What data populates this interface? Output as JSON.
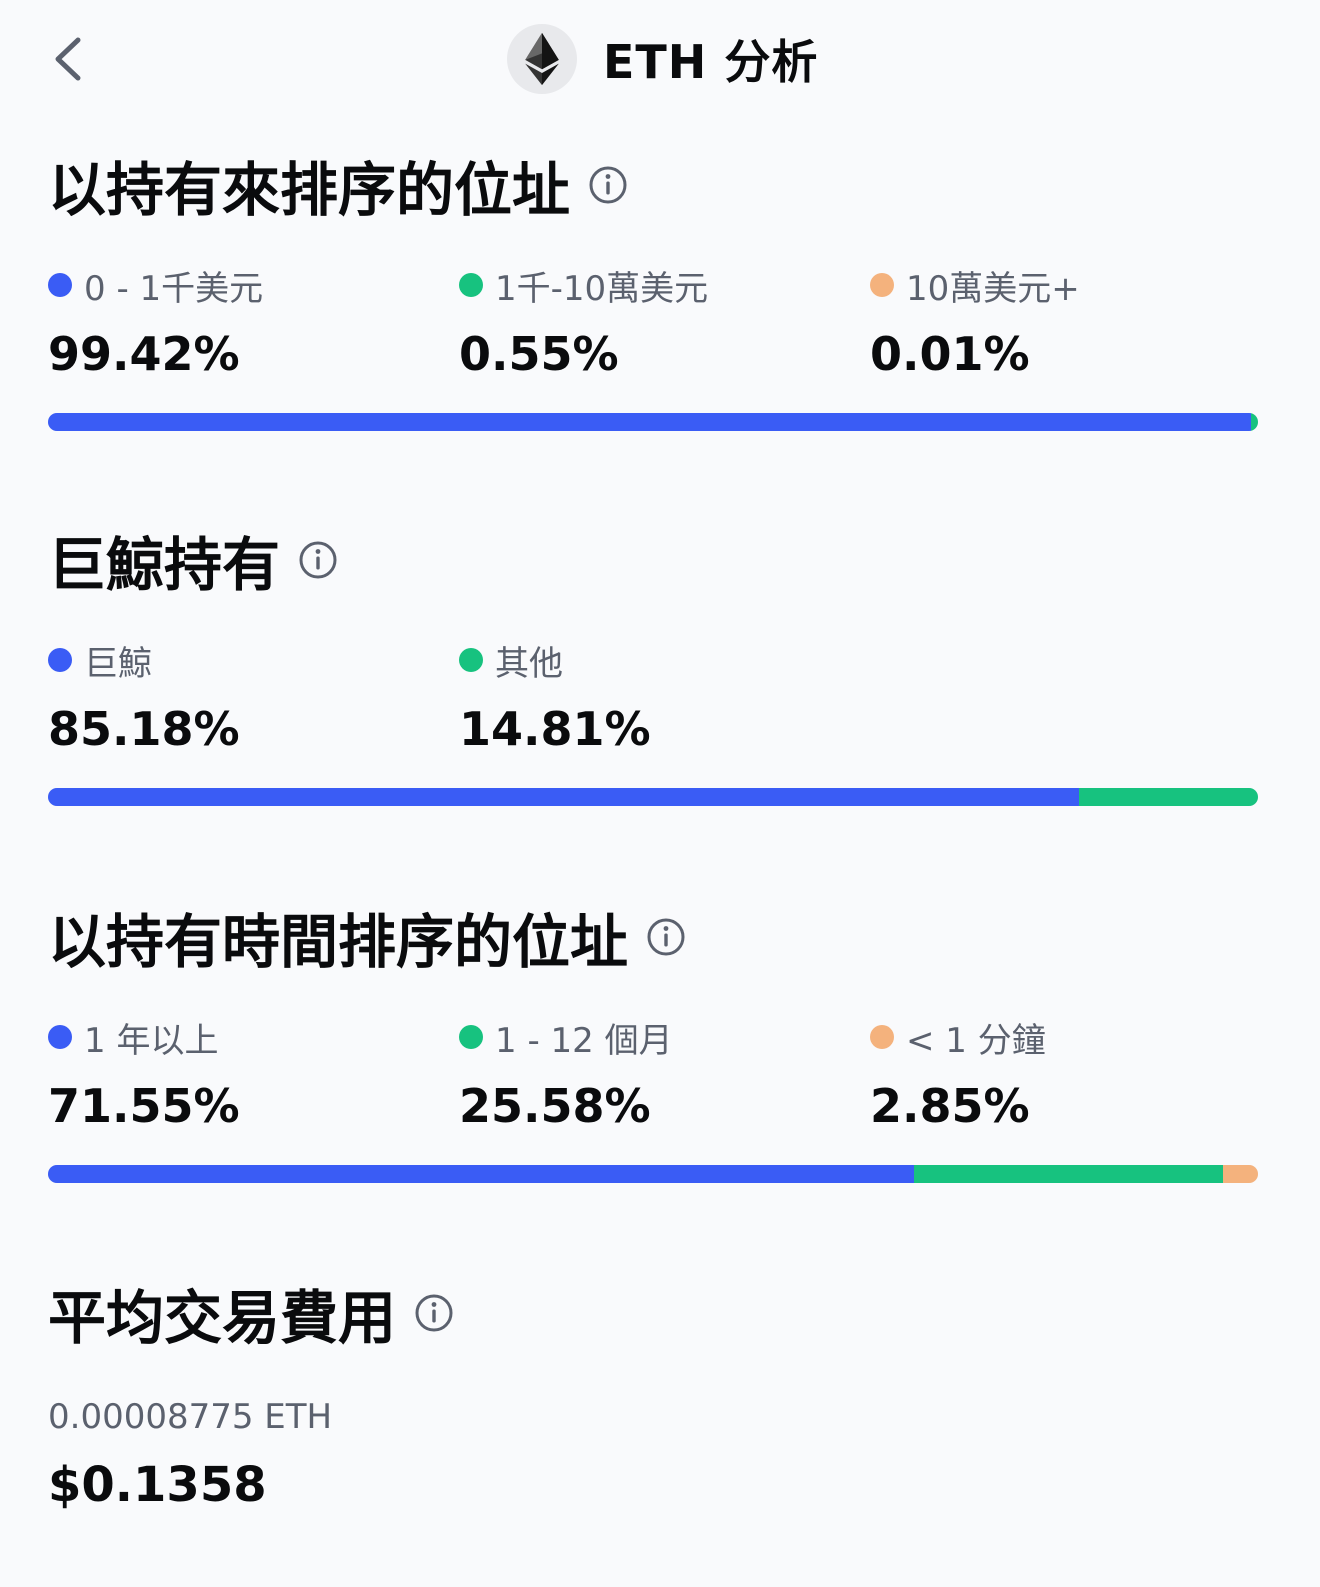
{
  "header": {
    "title": "ETH 分析",
    "back_icon": "chevron-left-icon",
    "logo_icon": "ethereum-logo-icon"
  },
  "colors": {
    "blue": "#3a5cf5",
    "green": "#17c27f",
    "orange": "#f4b27d"
  },
  "sections": {
    "by_holdings": {
      "title": "以持有來排序的位址",
      "items": [
        {
          "label": "0 - 1千美元",
          "value": "99.42%",
          "fraction": 0.9942,
          "color": "#3a5cf5"
        },
        {
          "label": "1千-10萬美元",
          "value": "0.55%",
          "fraction": 0.0055,
          "color": "#17c27f"
        },
        {
          "label": "10萬美元+",
          "value": "0.01%",
          "fraction": 0.0001,
          "color": "#f4b27d"
        }
      ]
    },
    "whales": {
      "title": "巨鯨持有",
      "items": [
        {
          "label": "巨鯨",
          "value": "85.18%",
          "fraction": 0.8518,
          "color": "#3a5cf5"
        },
        {
          "label": "其他",
          "value": "14.81%",
          "fraction": 0.1481,
          "color": "#17c27f"
        }
      ]
    },
    "by_time": {
      "title": "以持有時間排序的位址",
      "items": [
        {
          "label": "1 年以上",
          "value": "71.55%",
          "fraction": 0.7155,
          "color": "#3a5cf5"
        },
        {
          "label": "1 - 12 個月",
          "value": "25.58%",
          "fraction": 0.2558,
          "color": "#17c27f"
        },
        {
          "label": "< 1 分鐘",
          "value": "2.85%",
          "fraction": 0.0285,
          "color": "#f4b27d"
        }
      ]
    },
    "avg_fee": {
      "title": "平均交易費用",
      "eth_value": "0.00008775 ETH",
      "usd_value": "$0.1358"
    }
  }
}
